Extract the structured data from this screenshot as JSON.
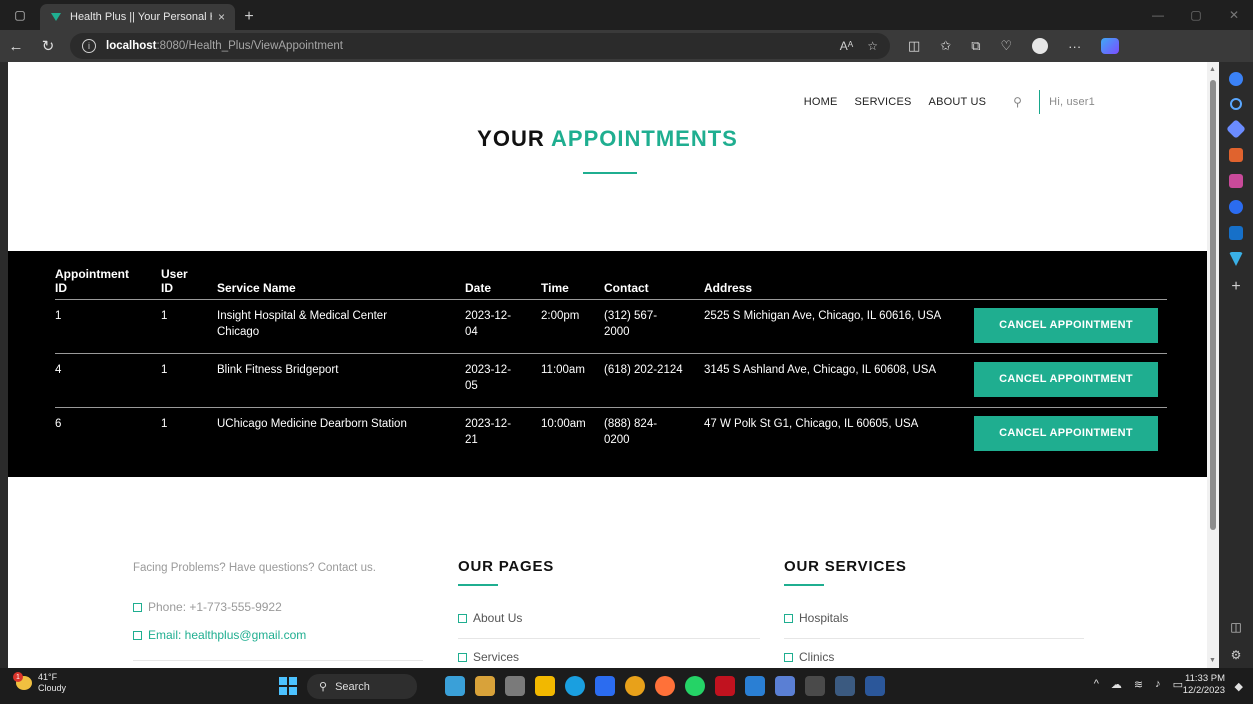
{
  "browser": {
    "tab_title": "Health Plus || Your Personal Heal",
    "tab_close": "×",
    "new_tab": "+",
    "url_host": "localhost",
    "url_path": ":8080/Health_Plus/ViewAppointment"
  },
  "site_nav": {
    "items": [
      "HOME",
      "SERVICES",
      "ABOUT US"
    ],
    "greeting": "Hi, user1"
  },
  "page_title": {
    "part1": "YOUR",
    "part2": "APPOINTMENTS"
  },
  "table": {
    "headers": {
      "appointment_id": "Appointment ID",
      "user_id": "User ID",
      "service_name": "Service Name",
      "date": "Date",
      "time": "Time",
      "contact": "Contact",
      "address": "Address"
    },
    "rows": [
      {
        "appointment_id": "1",
        "user_id": "1",
        "service_name": "Insight Hospital & Medical Center Chicago",
        "date": "2023-12-04",
        "time": "2:00pm",
        "contact": "(312) 567-2000",
        "address": "2525 S Michigan Ave, Chicago, IL 60616, USA",
        "action": "CANCEL APPOINTMENT"
      },
      {
        "appointment_id": "4",
        "user_id": "1",
        "service_name": "Blink Fitness Bridgeport",
        "date": "2023-12-05",
        "time": "11:00am",
        "contact": "(618) 202-2124",
        "address": "3145 S Ashland Ave, Chicago, IL 60608, USA",
        "action": "CANCEL APPOINTMENT"
      },
      {
        "appointment_id": "6",
        "user_id": "1",
        "service_name": "UChicago Medicine Dearborn Station",
        "date": "2023-12-21",
        "time": "10:00am",
        "contact": "(888) 824-0200",
        "address": "47 W Polk St G1, Chicago, IL 60605, USA",
        "action": "CANCEL APPOINTMENT"
      }
    ]
  },
  "footer": {
    "contact_prompt": "Facing Problems? Have questions? Contact us.",
    "phone": "Phone: +1-773-555-9922",
    "email": "Email: healthplus@gmail.com",
    "pages_heading": "OUR PAGES",
    "pages": [
      "About Us",
      "Services"
    ],
    "services_heading": "OUR SERVICES",
    "services": [
      "Hospitals",
      "Clinics"
    ]
  },
  "taskbar": {
    "temperature": "41°F",
    "condition": "Cloudy",
    "weather_badge": "1",
    "search": "Search",
    "time": "11:33 PM",
    "date": "12/2/2023"
  },
  "colors": {
    "accent": "#1fae90",
    "table_bg": "#000000"
  }
}
